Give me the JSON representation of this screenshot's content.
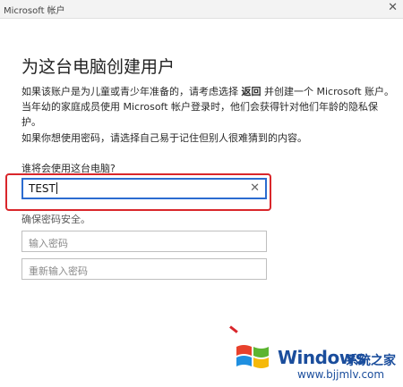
{
  "window": {
    "title": "Microsoft 帐户"
  },
  "dialog": {
    "heading": "为这台电脑创建用户",
    "para1_before": "如果该账户是为儿童或青少年准备的，请考虑选择 ",
    "para1_bold": "返回",
    "para1_after": " 并创建一个 Microsoft 账户。当年幼的家庭成员使用 Microsoft 帐户登录时，他们会获得针对他们年龄的隐私保护。",
    "para2": "如果你想使用密码，请选择自己易于记住但别人很难猜到的内容。",
    "question": "谁将会使用这台电脑?",
    "username_value": "TEST",
    "secure_note": "确保密码安全。",
    "password_placeholder": "输入密码",
    "confirm_placeholder": "重新输入密码"
  },
  "watermark": {
    "brand": "Windows",
    "cn": "系统之家",
    "url": "www.bjjmlv.com",
    "colors": {
      "red": "#e8412c",
      "green": "#5cb531",
      "blue": "#1f8fe0",
      "yellow": "#f5b90a",
      "text": "#1a4d9c"
    }
  },
  "colors": {
    "focus_border": "#2c6cd0",
    "highlight": "#d9262b"
  },
  "icons": {
    "close": "close-icon",
    "clear": "clear-icon",
    "logo": "windows-logo-icon"
  }
}
